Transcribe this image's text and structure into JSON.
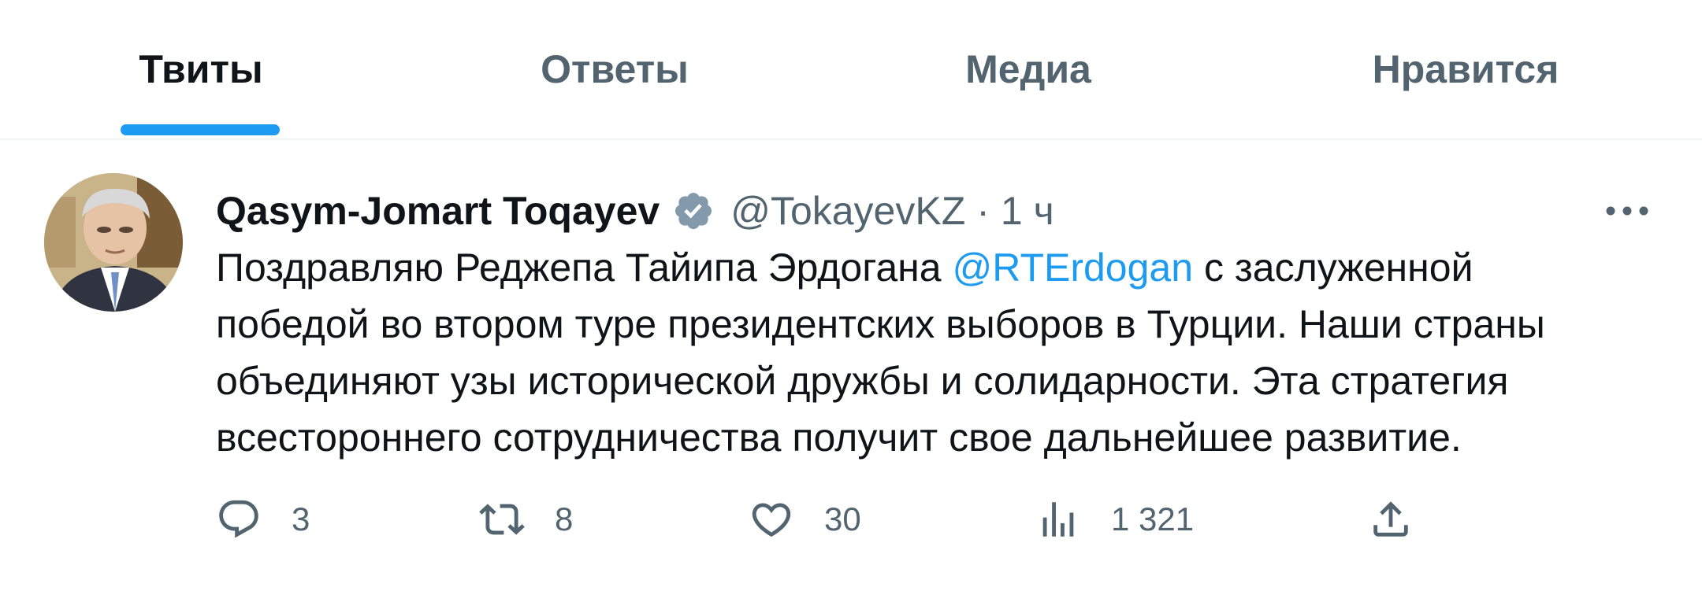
{
  "tabs": [
    {
      "label": "Твиты",
      "active": true
    },
    {
      "label": "Ответы",
      "active": false
    },
    {
      "label": "Медиа",
      "active": false
    },
    {
      "label": "Нравится",
      "active": false
    }
  ],
  "tweet": {
    "author_name": "Qasym-Jomart Toqayev",
    "verified_icon": "verified-badge-icon",
    "handle": "@TokayevKZ",
    "separator": "·",
    "time": "1 ч",
    "more_icon": "more-horizontal-icon",
    "text": {
      "line1_before": "Поздравляю Реджепа Тайипа Эрдогана ",
      "mention": "@RTErdogan",
      "line1_after": " с заслуженной",
      "line2": "победой во втором туре президентских выборов в Турции. Наши страны",
      "line3": "объединяют узы исторической дружбы и солидарности. Эта стратегия",
      "line4": "всестороннего сотрудничества получит свое дальнейшее развитие."
    },
    "actions": {
      "reply": {
        "icon": "reply-icon",
        "count": "3"
      },
      "retweet": {
        "icon": "retweet-icon",
        "count": "8"
      },
      "like": {
        "icon": "heart-icon",
        "count": "30"
      },
      "views": {
        "icon": "views-chart-icon",
        "count": "1 321"
      },
      "share": {
        "icon": "share-icon"
      }
    }
  },
  "colors": {
    "accent": "#1d9bf0",
    "text_primary": "#0f1419",
    "text_secondary": "#536471",
    "verified": "#829aab",
    "border": "#eff3f4"
  }
}
